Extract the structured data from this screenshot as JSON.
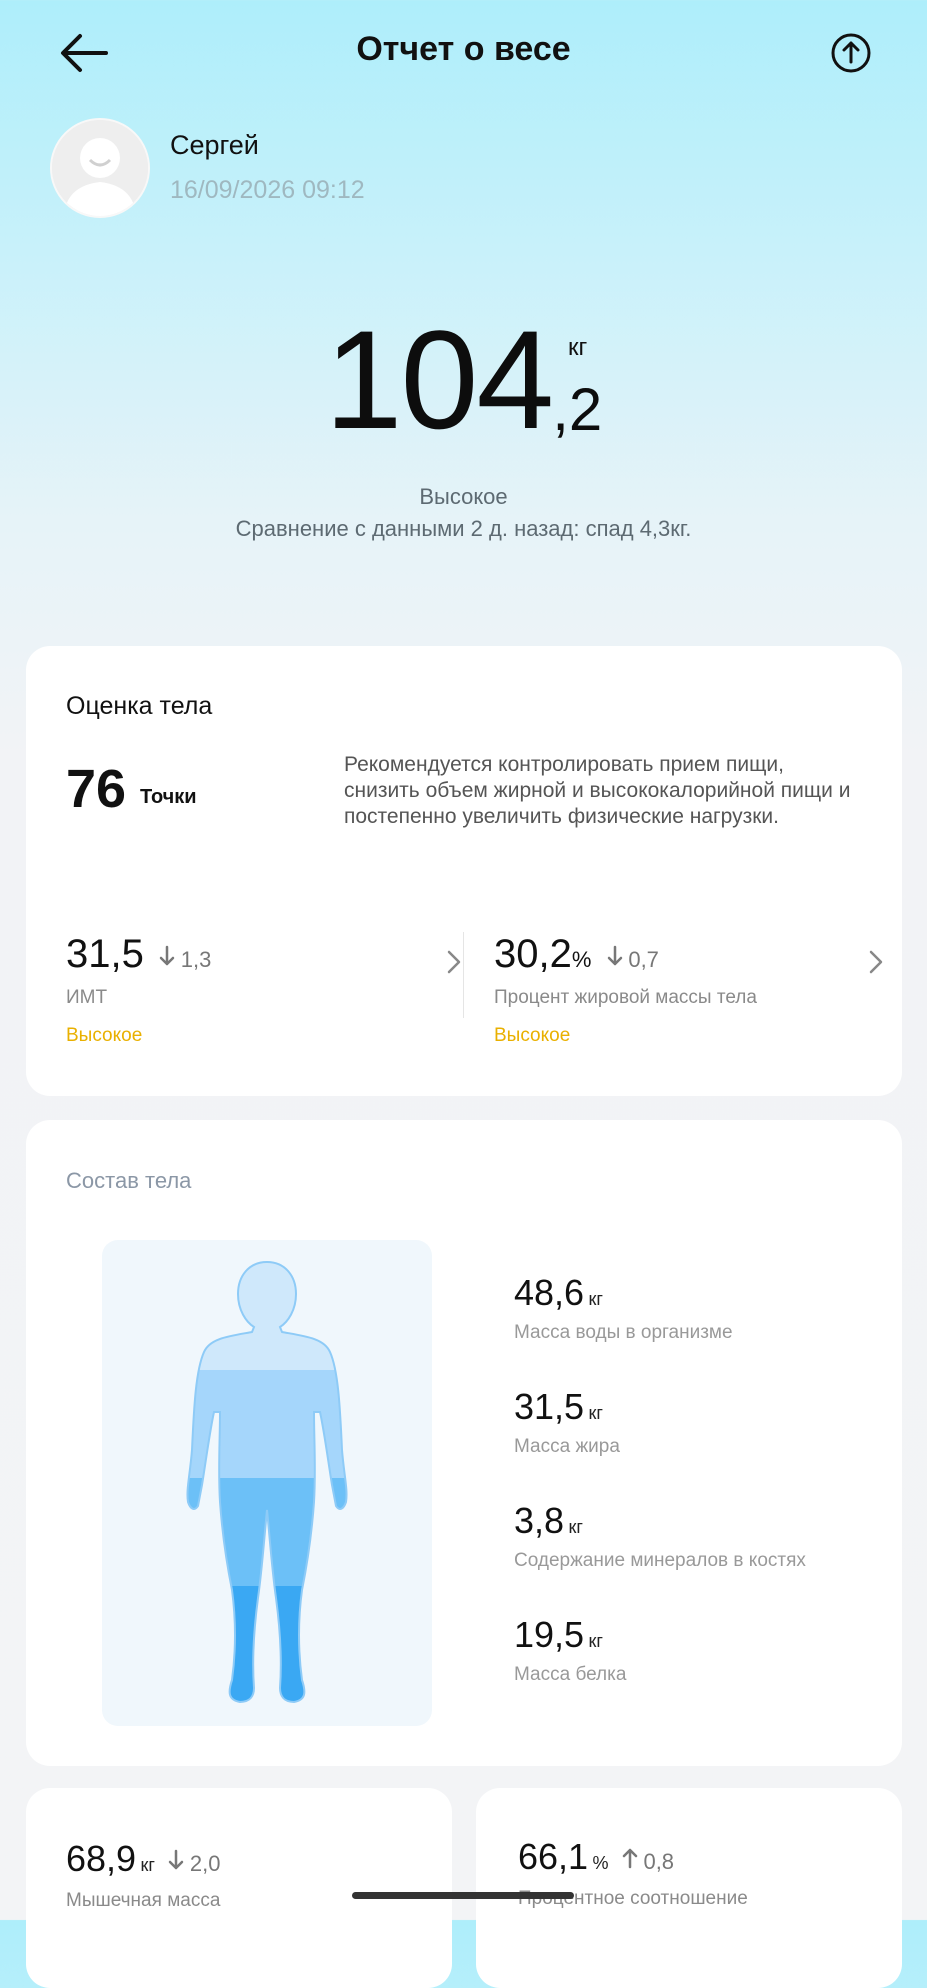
{
  "header": {
    "title": "Отчет о весе",
    "back_icon": "back-arrow-icon",
    "share_icon": "share-icon"
  },
  "profile": {
    "name": "Сергей",
    "date": "16/09/2026 09:12"
  },
  "weight": {
    "integer": "104",
    "decimal": ",2",
    "unit": "кг",
    "status": "Высокое",
    "comparison": "Сравнение с данными 2 д. назад: спад 4,3кг."
  },
  "score_card": {
    "title": "Оценка тела",
    "value": "76",
    "unit": "Точки",
    "advice": "Рекомендуется контролировать прием пищи, снизить объем жирной и высококалорийной пищи и постепенно увеличить физические нагрузки.",
    "bmi": {
      "value": "31,5",
      "delta": "1,3",
      "delta_dir": "down",
      "label": "ИМТ",
      "status": "Высокое"
    },
    "fat_pct": {
      "value": "30,2",
      "unit": "%",
      "delta": "0,7",
      "delta_dir": "down",
      "label": "Процент жировой массы тела",
      "status": "Высокое"
    }
  },
  "composition": {
    "title": "Состав тела",
    "items": [
      {
        "value": "48,6",
        "unit": "кг",
        "label": "Масса воды в организме"
      },
      {
        "value": "31,5",
        "unit": "кг",
        "label": "Масса жира"
      },
      {
        "value": "3,8",
        "unit": "кг",
        "label": "Содержание минералов в костях"
      },
      {
        "value": "19,5",
        "unit": "кг",
        "label": "Масса белка"
      }
    ]
  },
  "muscle": {
    "value": "68,9",
    "unit": "кг",
    "delta": "2,0",
    "delta_dir": "down",
    "label": "Мышечная масса"
  },
  "protein_ratio": {
    "value": "66,1",
    "unit": "%",
    "delta": "0,8",
    "delta_dir": "up",
    "label": "Процентное соотношение"
  },
  "colors": {
    "status_high": "#e9b000",
    "body_top": "#cfe8fb",
    "body_mid": "#a5d6fb",
    "body_low": "#6cc0f7",
    "body_legs": "#3aa8f3"
  }
}
